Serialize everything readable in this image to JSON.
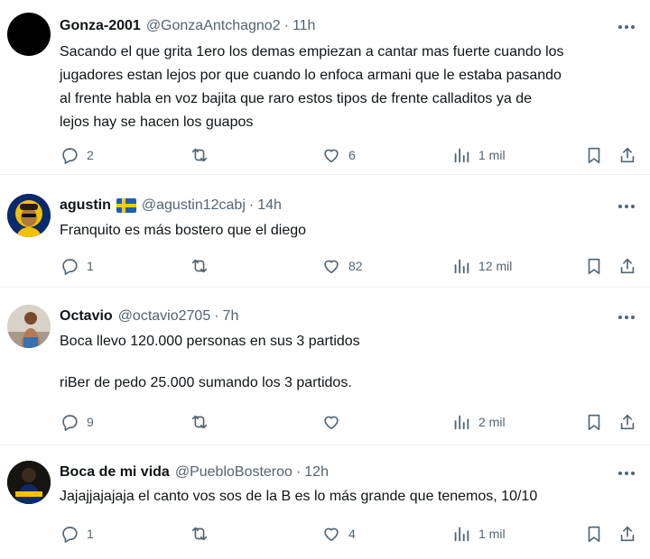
{
  "tweets": [
    {
      "name": "Gonza-2001",
      "handle": "@GonzaAntchagno2",
      "sep": "·",
      "time": "11h",
      "flag": "",
      "lines": [
        "Sacando el que grita 1ero los demas empiezan a cantar mas fuerte cuando los",
        "jugadores estan lejos por que cuando lo enfoca armani que le estaba pasando",
        "al frente habla en voz bajita que raro estos tipos de frente calladitos ya de",
        "lejos hay se hacen los guapos"
      ],
      "replies": "2",
      "retweets": "",
      "likes": "6",
      "views": "1 mil",
      "avatar": "black"
    },
    {
      "name": "agustin",
      "handle": "@agustin12cabj",
      "sep": "·",
      "time": "14h",
      "flag": "sweden-flag",
      "lines": [
        "Franquito es más bostero que el diego"
      ],
      "replies": "1",
      "retweets": "",
      "likes": "82",
      "views": "12 mil",
      "avatar": "cartoon"
    },
    {
      "name": "Octavio",
      "handle": "@octavio2705",
      "sep": "·",
      "time": "7h",
      "flag": "",
      "lines": [
        "Boca llevo 120.000 personas en sus 3 partidos",
        "",
        "riBer de pedo 25.000 sumando los 3 partidos."
      ],
      "replies": "9",
      "retweets": "",
      "likes": "",
      "views": "2 mil",
      "avatar": "photo"
    },
    {
      "name": "Boca de mi vida",
      "handle": "@PuebloBosteroo",
      "sep": "·",
      "time": "12h",
      "flag": "",
      "lines": [
        "Jajajjajajaja el canto vos sos de la B es lo más grande que tenemos, 10/10"
      ],
      "replies": "1",
      "retweets": "",
      "likes": "4",
      "views": "1 mil",
      "avatar": "boca"
    }
  ],
  "colors": {
    "text": "#0f1419",
    "muted": "#536471",
    "divider": "#eff3f4",
    "boca_blue": "#0a2a6b",
    "boca_gold": "#f2c200"
  }
}
